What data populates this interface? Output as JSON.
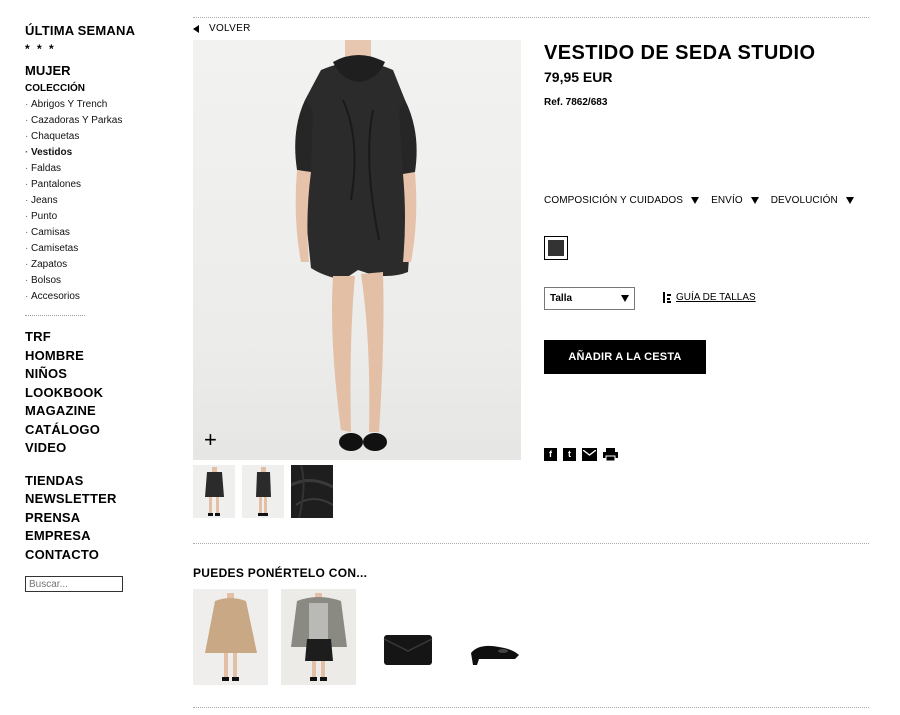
{
  "sidebar": {
    "top_link": "ÚLTIMA SEMANA",
    "stars": "* * *",
    "section": "MUJER",
    "subsection": "COLECCIÓN",
    "categories": [
      "Abrigos Y Trench",
      "Cazadoras Y Parkas",
      "Chaquetas",
      "Vestidos",
      "Faldas",
      "Pantalones",
      "Jeans",
      "Punto",
      "Camisas",
      "Camisetas",
      "Zapatos",
      "Bolsos",
      "Accesorios"
    ],
    "active_category": "Vestidos",
    "main_links": [
      "TRF",
      "HOMBRE",
      "NIÑOS",
      "LOOKBOOK",
      "MAGAZINE",
      "CATÁLOGO",
      "VIDEO"
    ],
    "secondary_links": [
      "TIENDAS",
      "NEWSLETTER",
      "PRENSA",
      "EMPRESA",
      "CONTACTO"
    ],
    "search_placeholder": "Buscar..."
  },
  "nav": {
    "back_label": "VOLVER"
  },
  "product": {
    "title": "VESTIDO DE SEDA STUDIO",
    "price": "79,95 EUR",
    "ref": "Ref. 7862/683",
    "info_tabs": [
      "COMPOSICIÓN Y CUIDADOS",
      "ENVÍO",
      "DEVOLUCIÓN"
    ],
    "color_swatch": "#333333",
    "size_select_value": "Talla",
    "size_guide_label": "GUÍA DE TALLAS",
    "add_to_cart_label": "AÑADIR A LA CESTA",
    "zoom_symbol": "+",
    "thumbnails": [
      "front-view",
      "side-view",
      "detail-view"
    ],
    "share_icons": [
      "facebook-icon",
      "tuenti-icon",
      "email-icon",
      "print-icon"
    ]
  },
  "recommendations": {
    "title": "PUEDES PONÉRTELO CON...",
    "items": [
      "camel-cape-coat",
      "grey-knit-cardigan",
      "black-clutch-bag",
      "black-patent-pumps"
    ]
  }
}
